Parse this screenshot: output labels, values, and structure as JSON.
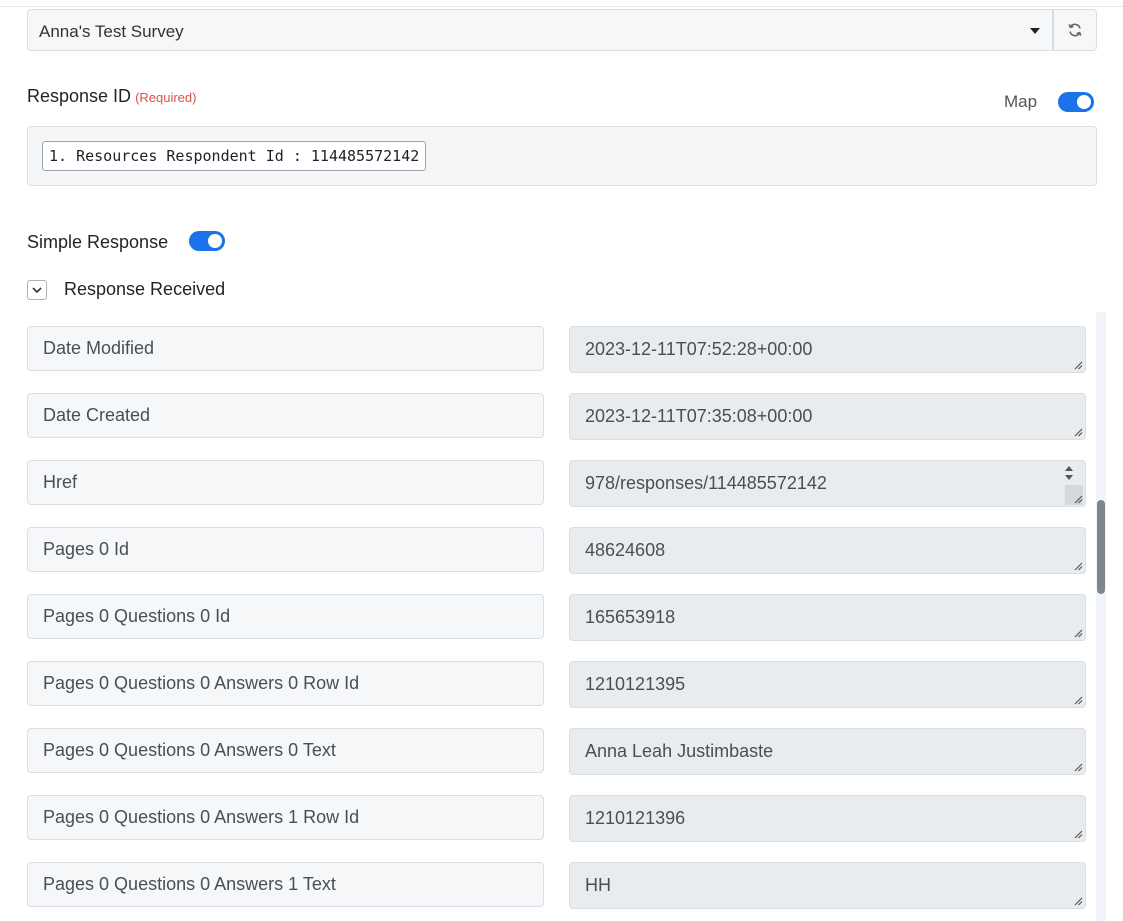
{
  "survey_select": {
    "selected": "Anna's Test Survey"
  },
  "response_id": {
    "label": "Response ID",
    "required": "(Required)",
    "map_label": "Map",
    "chip": "1. Resources Respondent Id : 114485572142"
  },
  "simple_response": {
    "label": "Simple Response"
  },
  "response_received": {
    "label": "Response Received"
  },
  "rows": [
    {
      "key": "Date Modified",
      "value": "2023-12-11T07:52:28+00:00"
    },
    {
      "key": "Date Created",
      "value": "2023-12-11T07:35:08+00:00"
    },
    {
      "key": "Href",
      "value": "978/responses/114485572142"
    },
    {
      "key": "Pages 0 Id",
      "value": "48624608"
    },
    {
      "key": "Pages 0 Questions 0 Id",
      "value": "165653918"
    },
    {
      "key": "Pages 0 Questions 0 Answers 0 Row Id",
      "value": "1210121395"
    },
    {
      "key": "Pages 0 Questions 0 Answers 0 Text",
      "value": "Anna Leah Justimbaste"
    },
    {
      "key": "Pages 0 Questions 0 Answers 1 Row Id",
      "value": "1210121396"
    },
    {
      "key": "Pages 0 Questions 0 Answers 1 Text",
      "value": "HH"
    }
  ]
}
